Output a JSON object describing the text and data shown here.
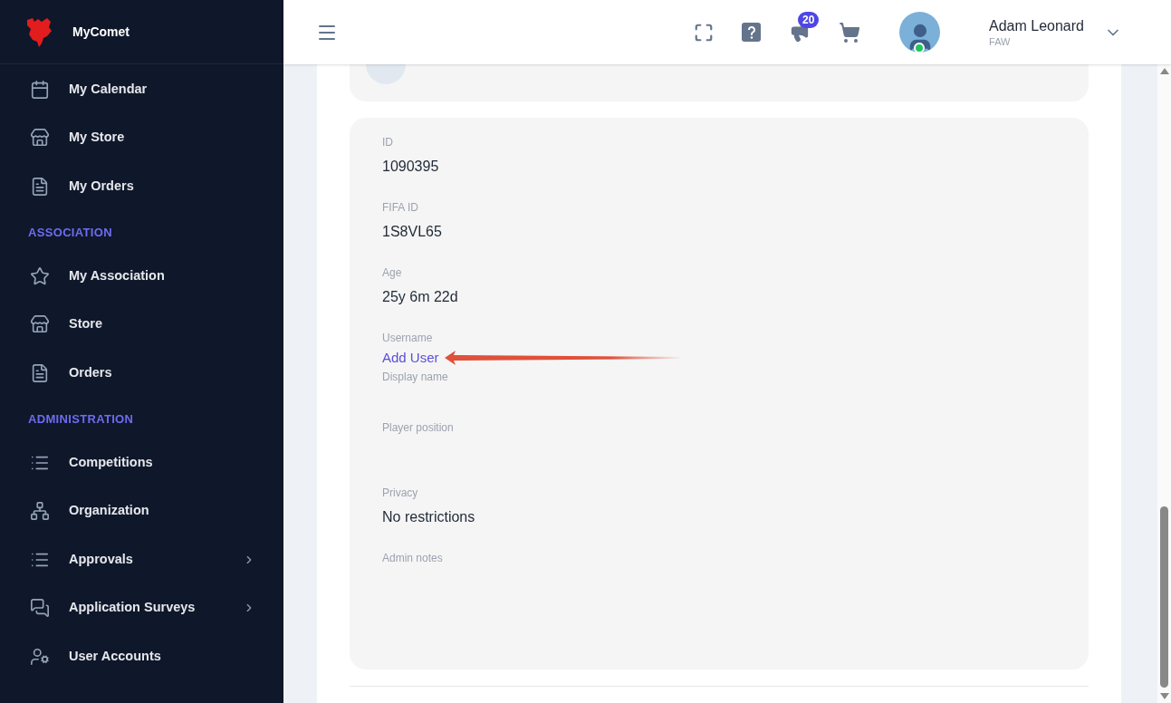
{
  "brand": {
    "name": "MyComet"
  },
  "sidebar": {
    "sections": [
      {
        "items": [
          {
            "label": "My Calendar",
            "expandable": false
          },
          {
            "label": "My Store",
            "expandable": false
          },
          {
            "label": "My Orders",
            "expandable": false
          }
        ]
      },
      {
        "heading": "ASSOCIATION",
        "items": [
          {
            "label": "My Association",
            "expandable": false
          },
          {
            "label": "Store",
            "expandable": false
          },
          {
            "label": "Orders",
            "expandable": false
          }
        ]
      },
      {
        "heading": "ADMINISTRATION",
        "items": [
          {
            "label": "Competitions",
            "expandable": false
          },
          {
            "label": "Organization",
            "expandable": false
          },
          {
            "label": "Approvals",
            "expandable": true
          },
          {
            "label": "Application Surveys",
            "expandable": true
          },
          {
            "label": "User Accounts",
            "expandable": false
          }
        ]
      }
    ]
  },
  "header": {
    "notifications_badge": "20",
    "user": {
      "name": "Adam Leonard",
      "org": "FAW",
      "online": true
    }
  },
  "details": [
    {
      "label": "ID",
      "value": "1090395",
      "kind": "text"
    },
    {
      "label": "FIFA ID",
      "value": "1S8VL65",
      "kind": "text"
    },
    {
      "label": "Age",
      "value": "25y 6m 22d",
      "kind": "text"
    },
    {
      "label": "Username",
      "value": "Add User",
      "kind": "link"
    },
    {
      "label": "Display name",
      "kind": "compact"
    },
    {
      "label": "Player position",
      "kind": "empty"
    },
    {
      "label": "Privacy",
      "value": "No restrictions",
      "kind": "text"
    },
    {
      "label": "Admin notes",
      "kind": "empty"
    }
  ]
}
